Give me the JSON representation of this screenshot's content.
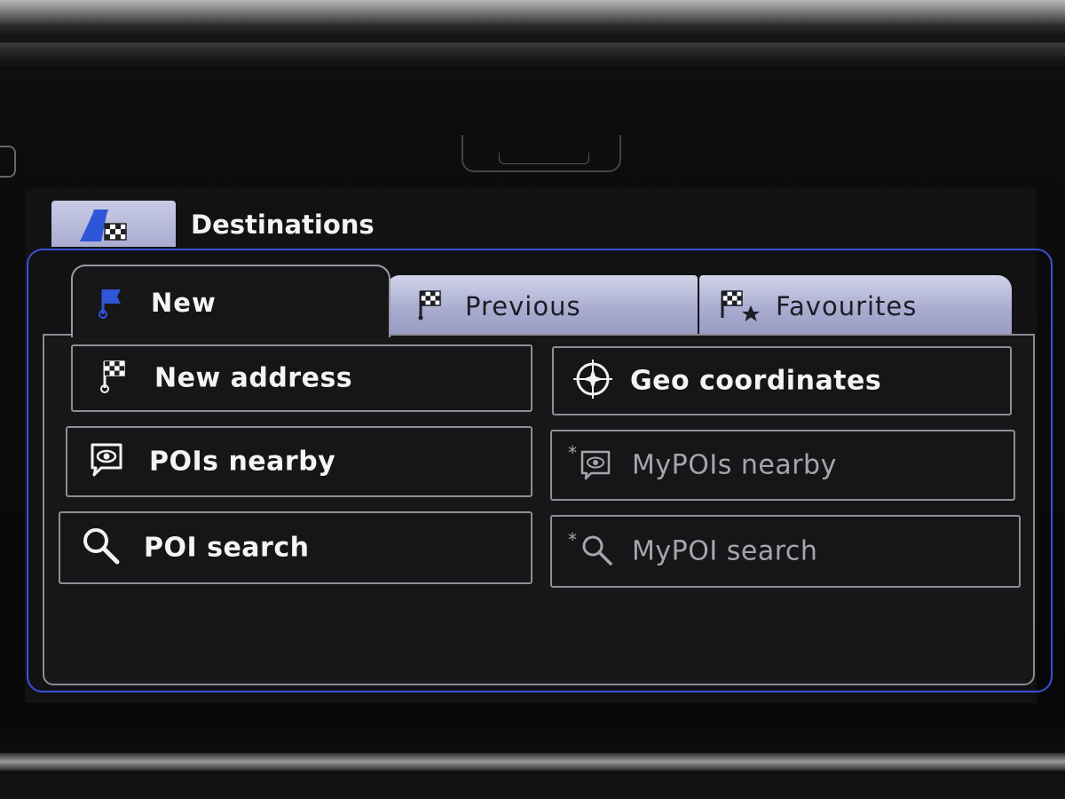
{
  "header": {
    "title": "Destinations",
    "icon": "destination-flag-icon"
  },
  "tabs": [
    {
      "label": "New",
      "icon": "blue-flag-icon",
      "active": true
    },
    {
      "label": "Previous",
      "icon": "checkered-flag-icon",
      "active": false
    },
    {
      "label": "Favourites",
      "icon": "flags-star-icon",
      "active": false
    }
  ],
  "menu": {
    "new_address": {
      "label": "New address",
      "icon": "flag-pin-icon",
      "enabled": true
    },
    "geo_coordinates": {
      "label": "Geo coordinates",
      "icon": "compass-icon",
      "enabled": true
    },
    "pois_nearby": {
      "label": "POIs nearby",
      "icon": "poi-eye-icon",
      "enabled": true
    },
    "mypois_nearby": {
      "label": "MyPOIs nearby",
      "icon": "star-poi-eye-icon",
      "enabled": false
    },
    "poi_search": {
      "label": "POI search",
      "icon": "search-icon",
      "enabled": true
    },
    "mypoi_search": {
      "label": "MyPOI search",
      "icon": "star-search-icon",
      "enabled": false
    }
  },
  "colors": {
    "accent_border": "#3d4fd8",
    "tab_inactive": "#a9acd0",
    "flag_blue": "#2f55d8"
  }
}
